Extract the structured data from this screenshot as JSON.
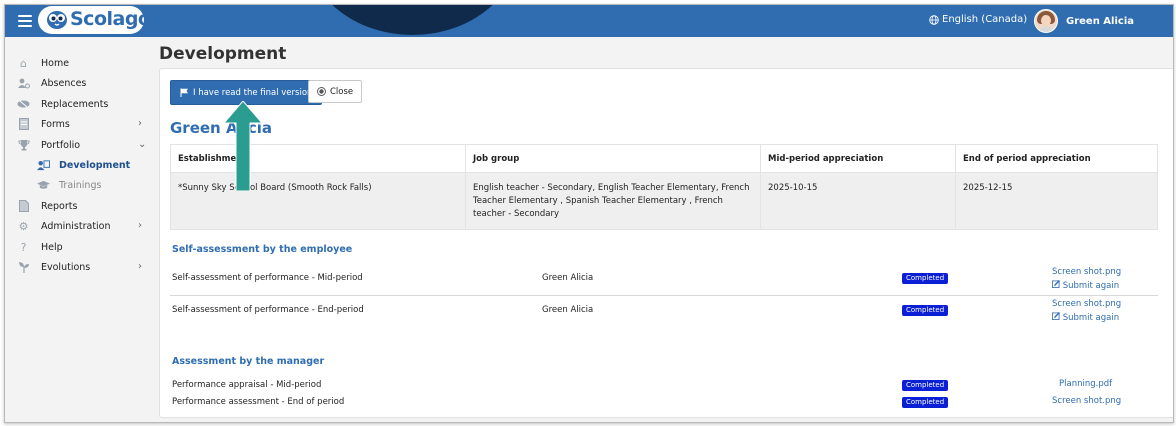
{
  "brand": {
    "logo_text": "Scolago"
  },
  "header": {
    "language": "English (Canada)",
    "user_name": "Green Alicia"
  },
  "sidebar": {
    "items": [
      {
        "label": "Home",
        "icon": "home-icon"
      },
      {
        "label": "Absences",
        "icon": "absences-icon"
      },
      {
        "label": "Replacements",
        "icon": "replacements-icon"
      },
      {
        "label": "Forms",
        "icon": "forms-icon",
        "chevron": "›"
      },
      {
        "label": "Portfolio",
        "icon": "trophy-icon",
        "chevron": "⌄"
      },
      {
        "label": "Development",
        "icon": "development-icon"
      },
      {
        "label": "Trainings",
        "icon": "graduation-cap-icon"
      },
      {
        "label": "Reports",
        "icon": "reports-icon"
      },
      {
        "label": "Administration",
        "icon": "gear-icon",
        "chevron": "›"
      },
      {
        "label": "Help",
        "icon": "help-icon"
      },
      {
        "label": "Evolutions",
        "icon": "sprout-icon",
        "chevron": "›"
      }
    ]
  },
  "main": {
    "title": "Development",
    "read_button": "I have read the final version",
    "close_button": "Close",
    "employee_name": "Green Alicia",
    "info_table": {
      "headers": [
        "Establishment",
        "Job group",
        "Mid-period appreciation",
        "End of period appreciation"
      ],
      "row": [
        "*Sunny Sky School Board (Smooth Rock Falls)",
        "English teacher - Secondary, English Teacher Elementary, French Teacher Elementary , Spanish Teacher Elementary , French teacher - Secondary",
        "2025-10-15",
        "2025-12-15"
      ]
    },
    "self_assessment": {
      "title": "Self-assessment by the employee",
      "rows": [
        {
          "name": "Self-assessment of performance - Mid-period",
          "person": "Green Alicia",
          "status": "Completed",
          "file": "Screen shot.png",
          "action": "Submit again"
        },
        {
          "name": "Self-assessment of performance - End-period",
          "person": "Green Alicia",
          "status": "Completed",
          "file": "Screen shot.png",
          "action": "Submit again"
        }
      ]
    },
    "manager_assessment": {
      "title": "Assessment by the manager",
      "rows": [
        {
          "name": "Performance appraisal - Mid-period",
          "status": "Completed",
          "file": "Planning.pdf"
        },
        {
          "name": "Performance assessment - End of period",
          "status": "Completed",
          "file": "Screen shot.png"
        }
      ]
    }
  },
  "colors": {
    "primary": "#2f6db0",
    "badge": "#0b1fd6",
    "arrow": "#2a9c90"
  }
}
